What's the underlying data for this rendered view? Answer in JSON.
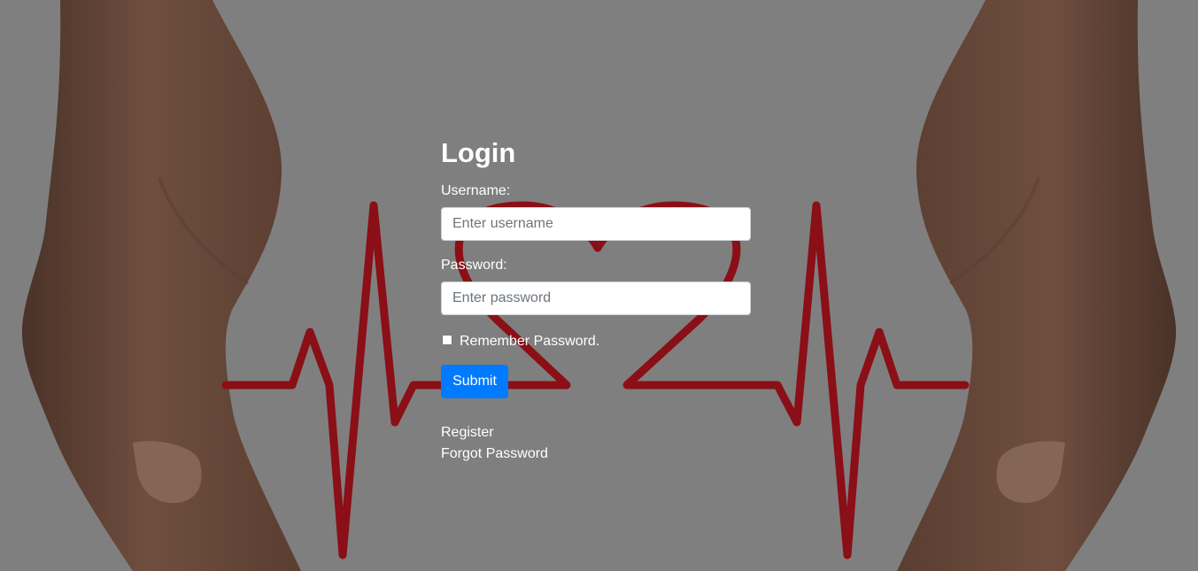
{
  "login": {
    "title": "Login",
    "username_label": "Username:",
    "username_placeholder": "Enter username",
    "username_value": "",
    "password_label": "Password:",
    "password_placeholder": "Enter password",
    "password_value": "",
    "remember_label": "Remember Password.",
    "remember_checked": false,
    "submit_label": "Submit",
    "register_link": "Register",
    "forgot_link": "Forgot Password"
  },
  "colors": {
    "background": "#7f7f7f",
    "primary_button": "#007bff",
    "heartbeat_line": "#8b0f16",
    "skin": "#6e4d3e"
  },
  "background_image": "hands-holding-heartbeat-heart"
}
